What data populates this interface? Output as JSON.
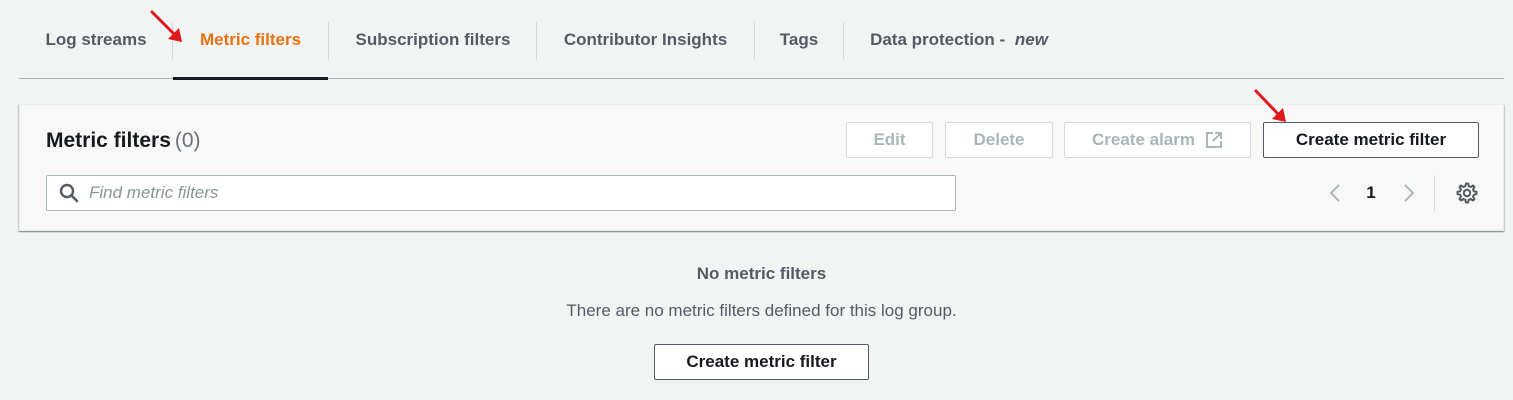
{
  "tabs": [
    {
      "label": "Log streams",
      "active": false
    },
    {
      "label": "Metric filters",
      "active": true
    },
    {
      "label": "Subscription filters",
      "active": false
    },
    {
      "label": "Contributor Insights",
      "active": false
    },
    {
      "label": "Tags",
      "active": false
    },
    {
      "label": "Data protection - ",
      "suffix": "new",
      "active": false
    }
  ],
  "panel": {
    "title": "Metric filters",
    "count": "(0)",
    "buttons": {
      "edit": "Edit",
      "delete": "Delete",
      "create_alarm": "Create alarm",
      "create_metric_filter": "Create metric filter"
    },
    "search": {
      "placeholder": "Find metric filters",
      "value": ""
    },
    "pagination": {
      "current_page": "1"
    }
  },
  "empty_state": {
    "title": "No metric filters",
    "description": "There are no metric filters defined for this log group.",
    "button": "Create metric filter"
  },
  "colors": {
    "accent": "#ec7211",
    "annotation_arrow": "#e0171b",
    "text": "#16191f",
    "muted": "#545b64"
  }
}
